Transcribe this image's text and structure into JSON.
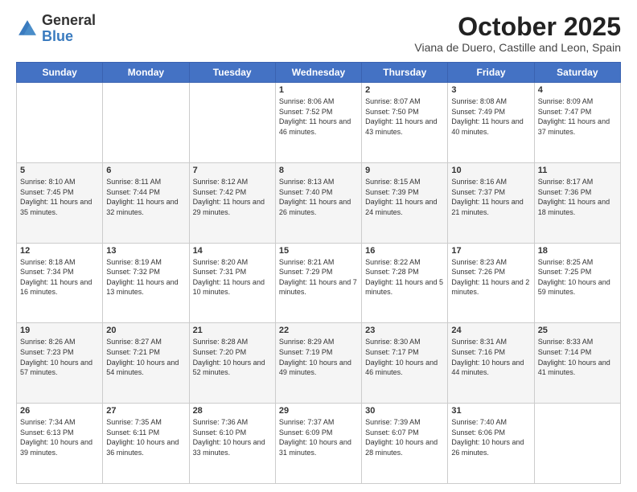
{
  "header": {
    "logo_general": "General",
    "logo_blue": "Blue",
    "month": "October 2025",
    "location": "Viana de Duero, Castille and Leon, Spain"
  },
  "days_of_week": [
    "Sunday",
    "Monday",
    "Tuesday",
    "Wednesday",
    "Thursday",
    "Friday",
    "Saturday"
  ],
  "weeks": [
    [
      {
        "day": "",
        "info": ""
      },
      {
        "day": "",
        "info": ""
      },
      {
        "day": "",
        "info": ""
      },
      {
        "day": "1",
        "info": "Sunrise: 8:06 AM\nSunset: 7:52 PM\nDaylight: 11 hours and 46 minutes."
      },
      {
        "day": "2",
        "info": "Sunrise: 8:07 AM\nSunset: 7:50 PM\nDaylight: 11 hours and 43 minutes."
      },
      {
        "day": "3",
        "info": "Sunrise: 8:08 AM\nSunset: 7:49 PM\nDaylight: 11 hours and 40 minutes."
      },
      {
        "day": "4",
        "info": "Sunrise: 8:09 AM\nSunset: 7:47 PM\nDaylight: 11 hours and 37 minutes."
      }
    ],
    [
      {
        "day": "5",
        "info": "Sunrise: 8:10 AM\nSunset: 7:45 PM\nDaylight: 11 hours and 35 minutes."
      },
      {
        "day": "6",
        "info": "Sunrise: 8:11 AM\nSunset: 7:44 PM\nDaylight: 11 hours and 32 minutes."
      },
      {
        "day": "7",
        "info": "Sunrise: 8:12 AM\nSunset: 7:42 PM\nDaylight: 11 hours and 29 minutes."
      },
      {
        "day": "8",
        "info": "Sunrise: 8:13 AM\nSunset: 7:40 PM\nDaylight: 11 hours and 26 minutes."
      },
      {
        "day": "9",
        "info": "Sunrise: 8:15 AM\nSunset: 7:39 PM\nDaylight: 11 hours and 24 minutes."
      },
      {
        "day": "10",
        "info": "Sunrise: 8:16 AM\nSunset: 7:37 PM\nDaylight: 11 hours and 21 minutes."
      },
      {
        "day": "11",
        "info": "Sunrise: 8:17 AM\nSunset: 7:36 PM\nDaylight: 11 hours and 18 minutes."
      }
    ],
    [
      {
        "day": "12",
        "info": "Sunrise: 8:18 AM\nSunset: 7:34 PM\nDaylight: 11 hours and 16 minutes."
      },
      {
        "day": "13",
        "info": "Sunrise: 8:19 AM\nSunset: 7:32 PM\nDaylight: 11 hours and 13 minutes."
      },
      {
        "day": "14",
        "info": "Sunrise: 8:20 AM\nSunset: 7:31 PM\nDaylight: 11 hours and 10 minutes."
      },
      {
        "day": "15",
        "info": "Sunrise: 8:21 AM\nSunset: 7:29 PM\nDaylight: 11 hours and 7 minutes."
      },
      {
        "day": "16",
        "info": "Sunrise: 8:22 AM\nSunset: 7:28 PM\nDaylight: 11 hours and 5 minutes."
      },
      {
        "day": "17",
        "info": "Sunrise: 8:23 AM\nSunset: 7:26 PM\nDaylight: 11 hours and 2 minutes."
      },
      {
        "day": "18",
        "info": "Sunrise: 8:25 AM\nSunset: 7:25 PM\nDaylight: 10 hours and 59 minutes."
      }
    ],
    [
      {
        "day": "19",
        "info": "Sunrise: 8:26 AM\nSunset: 7:23 PM\nDaylight: 10 hours and 57 minutes."
      },
      {
        "day": "20",
        "info": "Sunrise: 8:27 AM\nSunset: 7:21 PM\nDaylight: 10 hours and 54 minutes."
      },
      {
        "day": "21",
        "info": "Sunrise: 8:28 AM\nSunset: 7:20 PM\nDaylight: 10 hours and 52 minutes."
      },
      {
        "day": "22",
        "info": "Sunrise: 8:29 AM\nSunset: 7:19 PM\nDaylight: 10 hours and 49 minutes."
      },
      {
        "day": "23",
        "info": "Sunrise: 8:30 AM\nSunset: 7:17 PM\nDaylight: 10 hours and 46 minutes."
      },
      {
        "day": "24",
        "info": "Sunrise: 8:31 AM\nSunset: 7:16 PM\nDaylight: 10 hours and 44 minutes."
      },
      {
        "day": "25",
        "info": "Sunrise: 8:33 AM\nSunset: 7:14 PM\nDaylight: 10 hours and 41 minutes."
      }
    ],
    [
      {
        "day": "26",
        "info": "Sunrise: 7:34 AM\nSunset: 6:13 PM\nDaylight: 10 hours and 39 minutes."
      },
      {
        "day": "27",
        "info": "Sunrise: 7:35 AM\nSunset: 6:11 PM\nDaylight: 10 hours and 36 minutes."
      },
      {
        "day": "28",
        "info": "Sunrise: 7:36 AM\nSunset: 6:10 PM\nDaylight: 10 hours and 33 minutes."
      },
      {
        "day": "29",
        "info": "Sunrise: 7:37 AM\nSunset: 6:09 PM\nDaylight: 10 hours and 31 minutes."
      },
      {
        "day": "30",
        "info": "Sunrise: 7:39 AM\nSunset: 6:07 PM\nDaylight: 10 hours and 28 minutes."
      },
      {
        "day": "31",
        "info": "Sunrise: 7:40 AM\nSunset: 6:06 PM\nDaylight: 10 hours and 26 minutes."
      },
      {
        "day": "",
        "info": ""
      }
    ]
  ]
}
